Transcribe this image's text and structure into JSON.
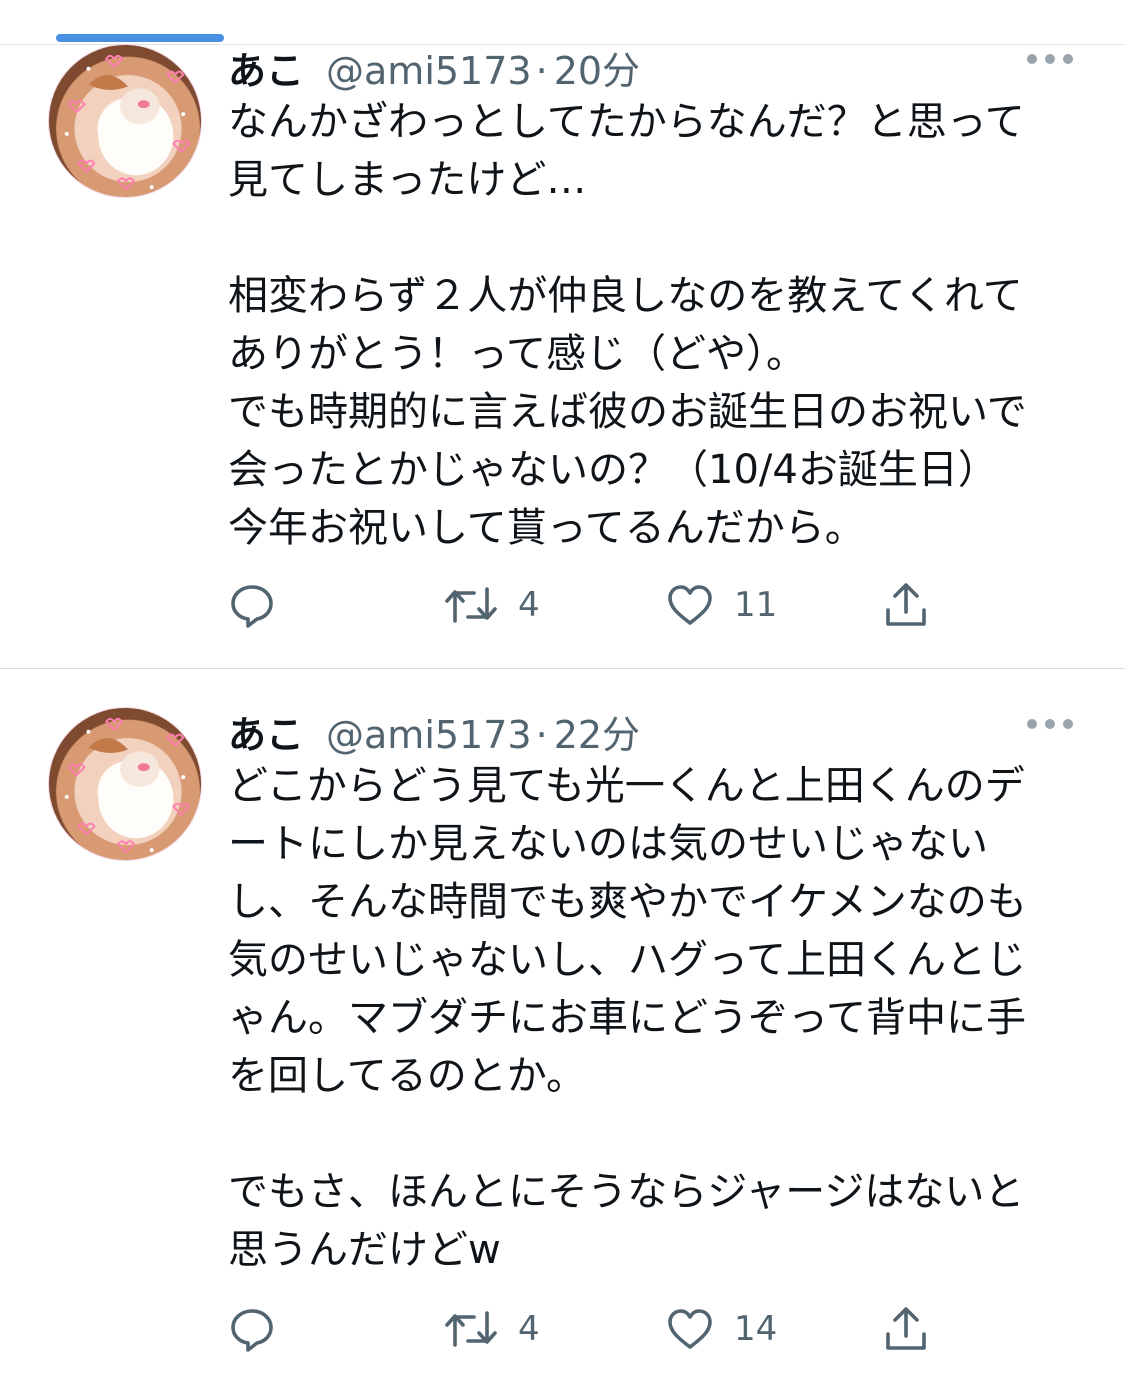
{
  "tweets": [
    {
      "display_name": "あこ",
      "handle": "@ami5173",
      "separator": "·",
      "time": "20分",
      "lines": [
        "なんかざわっとしてたからなんだ？と思って",
        "見てしまったけど…",
        "",
        "相変わらず２人が仲良しなのを教えてくれて",
        "ありがとう！って感じ（どや）。",
        "でも時期的に言えば彼のお誕生日のお祝いで",
        "会ったとかじゃないの？（10/4お誕生日）",
        "今年お祝いして貰ってるんだから。"
      ],
      "retweets": "4",
      "likes": "11"
    },
    {
      "display_name": "あこ",
      "handle": "@ami5173",
      "separator": "·",
      "time": "22分",
      "lines": [
        "どこからどう見ても光一くんと上田くんのデ",
        "ートにしか見えないのは気のせいじゃない",
        "し、そんな時間でも爽やかでイケメンなのも",
        "気のせいじゃないし、ハグって上田くんとじ",
        "ゃん。マブダチにお車にどうぞって背中に手",
        "を回してるのとか。",
        "",
        "でもさ、ほんとにそうならジャージはないと",
        "思うんだけどw"
      ],
      "retweets": "4",
      "likes": "14"
    }
  ],
  "icons": {
    "reply": "speech-bubble-icon",
    "retweet": "retweet-arrows-icon",
    "like": "heart-outline-icon",
    "share": "share-upload-icon",
    "more": "ellipsis-icon"
  },
  "colors": {
    "text_primary": "#0f1419",
    "text_secondary": "#536471",
    "divider": "#e1e4e8",
    "accent": "#4a90e2"
  }
}
